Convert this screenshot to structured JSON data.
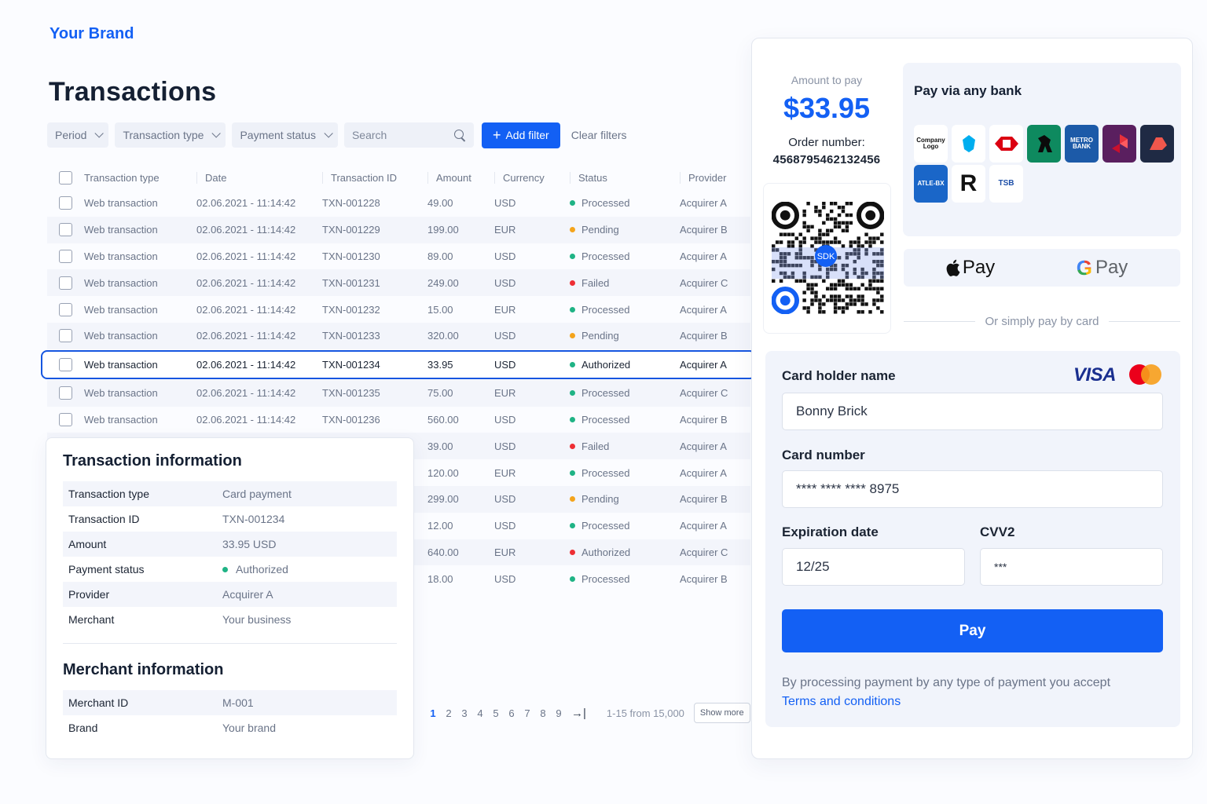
{
  "brand": "Your Brand",
  "page_title": "Transactions",
  "filters": {
    "period": "Period",
    "transaction_type": "Transaction type",
    "payment_status": "Payment status",
    "search_placeholder": "Search",
    "add_filter": "Add filter",
    "clear_filters": "Clear filters"
  },
  "table": {
    "headers": [
      "Transaction type",
      "Date",
      "Transaction ID",
      "Amount",
      "Currency",
      "Status",
      "Provider"
    ],
    "rows": [
      {
        "type": "Web transaction",
        "date": "02.06.2021 - 11:14:42",
        "id": "TXN-001228",
        "amount": "49.00",
        "currency": "USD",
        "status": "Processed",
        "status_color": "green",
        "provider": "Acquirer A"
      },
      {
        "type": "Web transaction",
        "date": "02.06.2021 - 11:14:42",
        "id": "TXN-001229",
        "amount": "199.00",
        "currency": "EUR",
        "status": "Pending",
        "status_color": "orange",
        "provider": "Acquirer B"
      },
      {
        "type": "Web transaction",
        "date": "02.06.2021 - 11:14:42",
        "id": "TXN-001230",
        "amount": "89.00",
        "currency": "USD",
        "status": "Processed",
        "status_color": "green",
        "provider": "Acquirer A"
      },
      {
        "type": "Web transaction",
        "date": "02.06.2021 - 11:14:42",
        "id": "TXN-001231",
        "amount": "249.00",
        "currency": "USD",
        "status": "Failed",
        "status_color": "red",
        "provider": "Acquirer C"
      },
      {
        "type": "Web transaction",
        "date": "02.06.2021 - 11:14:42",
        "id": "TXN-001232",
        "amount": "15.00",
        "currency": "EUR",
        "status": "Processed",
        "status_color": "green",
        "provider": "Acquirer A"
      },
      {
        "type": "Web transaction",
        "date": "02.06.2021 - 11:14:42",
        "id": "TXN-001233",
        "amount": "320.00",
        "currency": "USD",
        "status": "Pending",
        "status_color": "orange",
        "provider": "Acquirer B"
      },
      {
        "type": "Web transaction",
        "date": "02.06.2021 - 11:14:42",
        "id": "TXN-001234",
        "amount": "33.95",
        "currency": "USD",
        "status": "Authorized",
        "status_color": "green",
        "provider": "Acquirer A",
        "selected": true
      },
      {
        "type": "Web transaction",
        "date": "02.06.2021 - 11:14:42",
        "id": "TXN-001235",
        "amount": "75.00",
        "currency": "EUR",
        "status": "Processed",
        "status_color": "green",
        "provider": "Acquirer C"
      },
      {
        "type": "Web transaction",
        "date": "02.06.2021 - 11:14:42",
        "id": "TXN-001236",
        "amount": "560.00",
        "currency": "USD",
        "status": "Processed",
        "status_color": "green",
        "provider": "Acquirer B"
      },
      {
        "type": "",
        "date": "",
        "id": "",
        "amount": "39.00",
        "currency": "USD",
        "status": "Failed",
        "status_color": "red",
        "provider": "Acquirer A"
      },
      {
        "type": "",
        "date": "",
        "id": "",
        "amount": "120.00",
        "currency": "EUR",
        "status": "Processed",
        "status_color": "green",
        "provider": "Acquirer A"
      },
      {
        "type": "",
        "date": "",
        "id": "",
        "amount": "299.00",
        "currency": "USD",
        "status": "Pending",
        "status_color": "orange",
        "provider": "Acquirer B"
      },
      {
        "type": "",
        "date": "",
        "id": "",
        "amount": "12.00",
        "currency": "USD",
        "status": "Processed",
        "status_color": "green",
        "provider": "Acquirer A"
      },
      {
        "type": "",
        "date": "",
        "id": "",
        "amount": "640.00",
        "currency": "EUR",
        "status": "Authorized",
        "status_color": "red",
        "provider": "Acquirer C"
      },
      {
        "type": "",
        "date": "",
        "id": "",
        "amount": "18.00",
        "currency": "USD",
        "status": "Processed",
        "status_color": "green",
        "provider": "Acquirer B"
      }
    ]
  },
  "pagination": {
    "pages": [
      "1",
      "2",
      "3",
      "4",
      "5",
      "6",
      "7",
      "8",
      "9"
    ],
    "active_page": "1",
    "last_icon": "→|",
    "range": "1-15 from 15,000",
    "show_more": "Show more"
  },
  "transaction_info": {
    "title": "Transaction information",
    "rows": [
      {
        "key": "Transaction type",
        "value": "Card payment"
      },
      {
        "key": "Transaction ID",
        "value": "TXN-001234"
      },
      {
        "key": "Amount",
        "value": "33.95 USD"
      },
      {
        "key": "Payment status",
        "value": "Authorized",
        "status_color": "green"
      },
      {
        "key": "Provider",
        "value": "Acquirer A"
      },
      {
        "key": "Merchant",
        "value": "Your business"
      }
    ]
  },
  "merchant_info": {
    "title": "Merchant information",
    "rows": [
      {
        "key": "Merchant ID",
        "value": "M-001"
      },
      {
        "key": "Brand",
        "value": "Your brand"
      }
    ]
  },
  "payment": {
    "amount_label": "Amount to pay",
    "amount": "$33.95",
    "order_label": "Order number:",
    "order_number": "4568795462132456",
    "qr_badge": "SDK",
    "bank_title": "Pay via any bank",
    "bank_logos": [
      {
        "name": "company-logo",
        "text": "Company Logo",
        "bg": "#ffffff"
      },
      {
        "name": "eagle-bank-logo",
        "text": "",
        "bg": "#ffffff"
      },
      {
        "name": "hexagon-bank-logo",
        "text": "",
        "bg": "#ffffff"
      },
      {
        "name": "horse-bank-logo",
        "text": "",
        "bg": "#0e8a5f"
      },
      {
        "name": "metro-bank-logo",
        "text": "METRO BANK",
        "bg": "#1c5aa8"
      },
      {
        "name": "natwest-logo",
        "text": "",
        "bg": "#5a1f5f"
      },
      {
        "name": "red-bank-logo",
        "text": "",
        "bg": "#1f2a44"
      },
      {
        "name": "x-bank-logo",
        "text": "ATLE-BX",
        "bg": "#1a66c8"
      },
      {
        "name": "revolut-logo",
        "text": "R",
        "bg": "#ffffff"
      },
      {
        "name": "tsb-logo",
        "text": "TSB",
        "bg": "#ffffff"
      }
    ],
    "apple_pay": "Pay",
    "google_pay": "Pay",
    "or_text": "Or simply pay by card",
    "card_holder_label": "Card holder name",
    "card_holder_value": "Bonny Brick",
    "card_brand": "VISA",
    "card_number_label": "Card number",
    "card_number_value": "**** **** **** 8975",
    "expiration_label": "Expiration date",
    "expiration_value": "12/25",
    "cvv_label": "CVV2",
    "cvv_value": "***",
    "pay_button": "Pay",
    "terms_text": "By processing payment by any type of payment you accept",
    "terms_link": "Terms and conditions"
  },
  "colors": {
    "accent": "#1360f4",
    "status_green": "#1fb385",
    "status_orange": "#f4a41c",
    "status_red": "#ee2e34"
  }
}
